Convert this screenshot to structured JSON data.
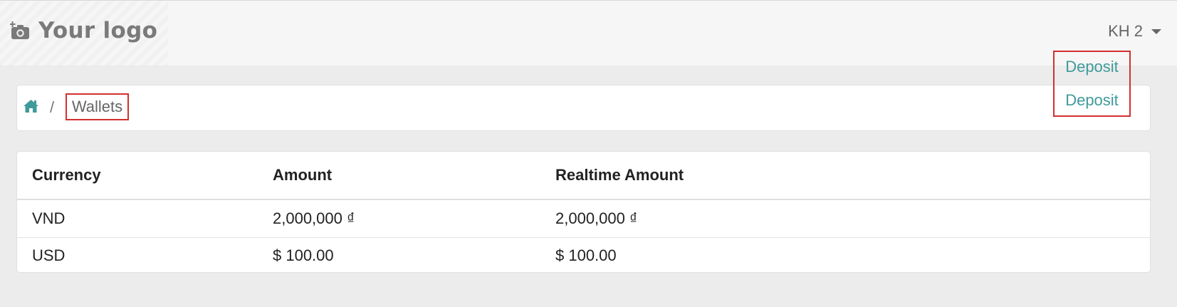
{
  "header": {
    "logo_text": "Your logo",
    "logo_icon": "camera-icon",
    "user_label": "KH 2",
    "user_icon": "caret-down-icon"
  },
  "breadcrumb": {
    "home_icon": "home-icon",
    "separator": "/",
    "current": "Wallets"
  },
  "table": {
    "columns": [
      "Currency",
      "Amount",
      "Realtime Amount"
    ],
    "rows": [
      {
        "currency": "VND",
        "amount": "2,000,000 ₫",
        "realtime_amount": "2,000,000 ₫",
        "action": "Deposit"
      },
      {
        "currency": "USD",
        "amount": "$ 100.00",
        "realtime_amount": "$ 100.00",
        "action": "Deposit"
      }
    ]
  },
  "colors": {
    "accent": "#3f9a9a",
    "highlight_border": "#d32f2f",
    "page_background": "#ececec"
  }
}
